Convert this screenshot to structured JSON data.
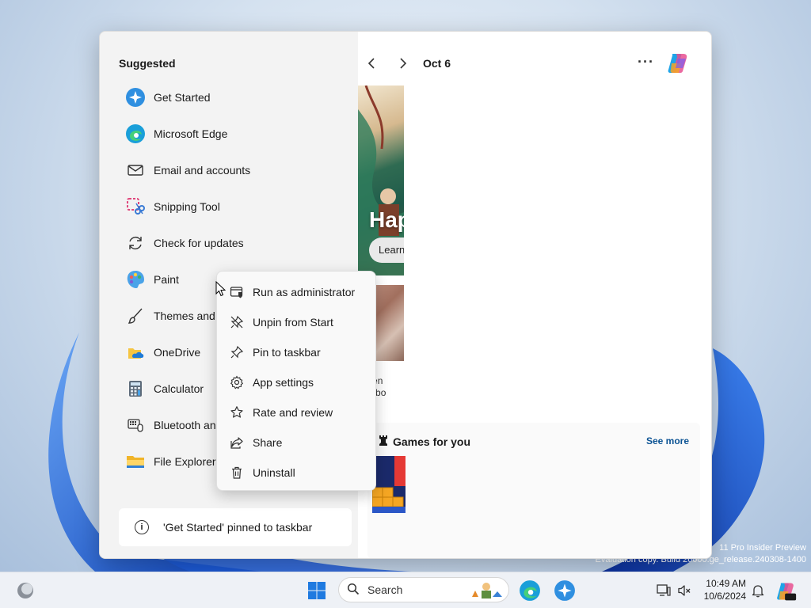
{
  "desktop": {
    "watermark_line1": "11 Pro Insider Preview",
    "watermark_line2": "Evaluation copy. Build 26000.ge_release.240308-1400"
  },
  "start_menu": {
    "suggested_title": "Suggested",
    "apps": [
      {
        "label": "Get Started",
        "icon": "get-started-icon"
      },
      {
        "label": "Microsoft Edge",
        "icon": "edge-icon"
      },
      {
        "label": "Email and accounts",
        "icon": "mail-icon"
      },
      {
        "label": "Snipping Tool",
        "icon": "snipping-tool-icon"
      },
      {
        "label": "Check for updates",
        "icon": "refresh-icon"
      },
      {
        "label": "Paint",
        "icon": "paint-icon"
      },
      {
        "label": "Themes and",
        "icon": "brush-icon"
      },
      {
        "label": "OneDrive",
        "icon": "onedrive-icon"
      },
      {
        "label": "Calculator",
        "icon": "calculator-icon"
      },
      {
        "label": "Bluetooth an",
        "icon": "bluetooth-devices-icon"
      },
      {
        "label": "File Explorer",
        "icon": "folder-icon"
      }
    ],
    "notice": "'Get Started' pinned to taskbar",
    "feed": {
      "date": "Oct 6",
      "hero_text": "Hap",
      "hero_button": "Learn",
      "card_text_line1": "idden",
      "card_text_line2": "the bo",
      "games_title": "Games for you",
      "see_more": "See more"
    }
  },
  "context_menu": {
    "items": [
      {
        "label": "Run as administrator",
        "icon": "shield-window-icon"
      },
      {
        "label": "Unpin from Start",
        "icon": "unpin-icon"
      },
      {
        "label": "Pin to taskbar",
        "icon": "pin-icon"
      },
      {
        "label": "App settings",
        "icon": "gear-icon"
      },
      {
        "label": "Rate and review",
        "icon": "star-icon"
      },
      {
        "label": "Share",
        "icon": "share-icon"
      },
      {
        "label": "Uninstall",
        "icon": "trash-icon"
      }
    ]
  },
  "taskbar": {
    "search_placeholder": "Search",
    "time": "10:49 AM",
    "date": "10/6/2024"
  },
  "colors": {
    "accent": "#0067c0",
    "see_more": "#0b5394"
  }
}
